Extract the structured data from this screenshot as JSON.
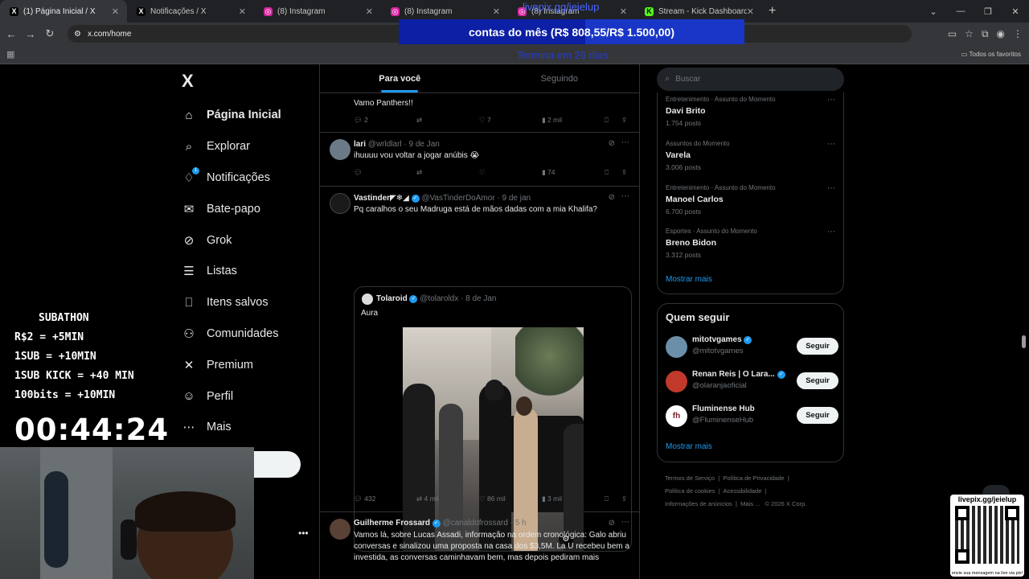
{
  "browser": {
    "tabs": [
      {
        "title": "(1) Página Inicial / X",
        "icon": "x-icon",
        "active": true
      },
      {
        "title": "Notificações / X",
        "icon": "x-icon",
        "active": false
      },
      {
        "title": "(8) Instagram",
        "icon": "instagram-icon",
        "active": false
      },
      {
        "title": "(8) Instagram",
        "icon": "instagram-icon",
        "active": false
      },
      {
        "title": "(8) Instagram",
        "icon": "instagram-icon",
        "active": false
      },
      {
        "title": "Stream - Kick Dashboard",
        "icon": "kick-icon",
        "active": false
      }
    ],
    "url": "x.com/home",
    "bookmarks_label": "Todos os favoritos"
  },
  "overlay": {
    "livepix_link": "livepix.gg/jeielup",
    "goal_text": "contas do mês (R$ 808,55/R$ 1.500,00)",
    "goal_progress": 0.539,
    "ends_text": "Termina em 26 dias",
    "subathon": {
      "title": "SUBATHON",
      "lines": [
        "R$2 = +5MIN",
        "1SUB  =  +10MIN",
        "1SUB KICK = +40 MIN",
        "100bits = +10MIN"
      ]
    },
    "timer": "00:44:24",
    "qr_label": "livepix.gg/jeielup",
    "qr_caption": "envie sua mensagem na live via pix!"
  },
  "sidebar": {
    "logo": "X",
    "items": [
      {
        "label": "Página Inicial",
        "icon": "home-icon",
        "glyph": "⌂"
      },
      {
        "label": "Explorar",
        "icon": "search-icon",
        "glyph": "⌕"
      },
      {
        "label": "Notificações",
        "icon": "bell-icon",
        "glyph": "🔔",
        "badge": "1"
      },
      {
        "label": "Bate-papo",
        "icon": "mail-icon",
        "glyph": "✉"
      },
      {
        "label": "Grok",
        "icon": "grok-icon",
        "glyph": "⊘"
      },
      {
        "label": "Listas",
        "icon": "list-icon",
        "glyph": "☰"
      },
      {
        "label": "Itens salvos",
        "icon": "bookmark-icon",
        "glyph": "⎕"
      },
      {
        "label": "Comunidades",
        "icon": "communities-icon",
        "glyph": "⚇"
      },
      {
        "label": "Premium",
        "icon": "x-premium-icon",
        "glyph": "✕"
      },
      {
        "label": "Perfil",
        "icon": "profile-icon",
        "glyph": "☺"
      },
      {
        "label": "Mais",
        "icon": "more-icon",
        "glyph": "⋯"
      }
    ]
  },
  "feed": {
    "tabs": [
      "Para você",
      "Seguindo"
    ],
    "posts": [
      {
        "text": "Vamo Panthers!!",
        "replies": "2",
        "reposts": "",
        "likes": "7",
        "views": "2 mil"
      },
      {
        "name": "lari",
        "handle": "@wrldlarl · 9 de Jan",
        "text": "ihuuuu vou voltar a jogar anúbis 😭",
        "replies": "",
        "reposts": "",
        "likes": "",
        "views": "74"
      },
      {
        "name": "Vastinder◤❄◢",
        "handle": "@VasTinderDoAmor · 9 de jan",
        "text": "Pq caralhos o seu Madruga está de mãos dadas com a mia Khalifa?",
        "quote": {
          "name": "Tolaroid",
          "handle": "@tolaroldx · 8 de Jan",
          "text": "Aura"
        },
        "replies": "432",
        "reposts": "4 mil",
        "likes": "86 mil",
        "views": "3 mil"
      },
      {
        "name": "Guilherme Frossard",
        "handle": "@canaldofrossard · 5 h",
        "text": "Vamos lá, sobre Lucas Assadi, informação na ordem cronológica: Galo abriu conversas e sinalizou uma proposta na casa dos $3,5M. La U recebeu bem a investida, as conversas caminhavam bem, mas depois pediram mais"
      }
    ]
  },
  "right": {
    "search_placeholder": "Buscar",
    "trends": [
      {
        "context": "Entretenimento · Assunto do Momento",
        "name": "Davi Brito",
        "posts": "1.754 posts"
      },
      {
        "context": "Assuntos do Momento",
        "name": "Varela",
        "posts": "3.006 posts"
      },
      {
        "context": "Entretenimento · Assunto do Momento",
        "name": "Manoel Carlos",
        "posts": "6.700 posts"
      },
      {
        "context": "Esportes · Assunto do Momento",
        "name": "Breno Bidon",
        "posts": "3.312 posts"
      }
    ],
    "show_more": "Mostrar mais",
    "who_title": "Quem seguir",
    "who": [
      {
        "name": "mitotvgames",
        "handle": "@mitotvgames",
        "button": "Seguir"
      },
      {
        "name": "Renan Reis | O Lara...",
        "handle": "@olaranjaoficial",
        "button": "Seguir"
      },
      {
        "name": "Fluminense Hub",
        "handle": "@FluminenseHub",
        "button": "Seguir"
      }
    ],
    "who_more": "Mostrar mais",
    "footer": [
      "Termos de Serviço",
      "|",
      "Política de Privacidade",
      "|",
      "Política de cookies",
      "|",
      "Acessibilidade",
      "|",
      "Informações de anúncios",
      "|",
      "Mais ...",
      "© 2026 X Corp."
    ],
    "colors": {
      "accent": "#1d9bf0",
      "bg": "#000000",
      "border": "#2f3336"
    }
  }
}
